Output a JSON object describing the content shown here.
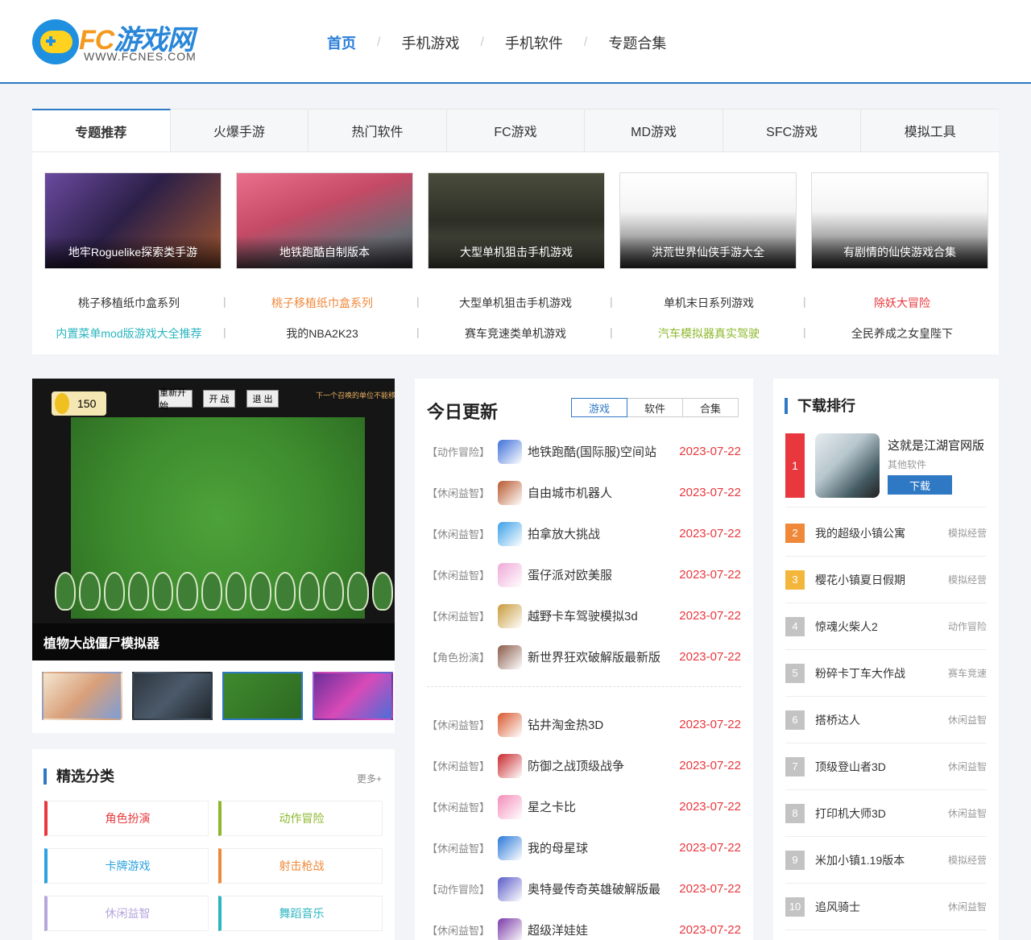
{
  "logo": {
    "title_fc": "FC",
    "title_rest": "游戏网",
    "url": "WWW.FCNES.COM"
  },
  "nav": [
    {
      "label": "首页",
      "active": true
    },
    {
      "label": "手机游戏"
    },
    {
      "label": "手机软件"
    },
    {
      "label": "专题合集"
    }
  ],
  "nav_sep": "/",
  "topics": {
    "tabs": [
      "专题推荐",
      "火爆手游",
      "热门软件",
      "FC游戏",
      "MD游戏",
      "SFC游戏",
      "模拟工具"
    ],
    "cards": [
      "地牢Roguelike探索类手游",
      "地铁跑酷自制版本",
      "大型单机狙击手机游戏",
      "洪荒世界仙侠手游大全",
      "有剧情的仙侠游戏合集"
    ],
    "links_row1": [
      {
        "text": "桃子移植纸巾盒系列",
        "color": "#333333"
      },
      {
        "text": "桃子移植纸巾盒系列",
        "color": "#f0883a"
      },
      {
        "text": "大型单机狙击手机游戏",
        "color": "#333333"
      },
      {
        "text": "单机末日系列游戏",
        "color": "#333333"
      },
      {
        "text": "除妖大冒险",
        "color": "#e8383d"
      }
    ],
    "links_row2": [
      {
        "text": "内置菜单mod版游戏大全推荐",
        "color": "#2bb5c0"
      },
      {
        "text": "我的NBA2K23",
        "color": "#333333"
      },
      {
        "text": "赛车竞速类单机游戏",
        "color": "#333333"
      },
      {
        "text": "汽车模拟器真实驾驶",
        "color": "#8cb82b"
      },
      {
        "text": "全民养成之女皇陛下",
        "color": "#333333"
      }
    ]
  },
  "slider": {
    "caption": "植物大战僵尸模拟器",
    "game": {
      "coins": "150",
      "btn_restart": "重新开始",
      "btn_fight": "开 战",
      "btn_exit": "退 出",
      "hint": "下一个召唤的单位不能移动"
    }
  },
  "categories": {
    "title": "精选分类",
    "more": "更多+",
    "items": [
      {
        "label": "角色扮演",
        "color": "#e8383d"
      },
      {
        "label": "动作冒险",
        "color": "#8cb82b"
      },
      {
        "label": "卡牌游戏",
        "color": "#2ba3e0"
      },
      {
        "label": "射击枪战",
        "color": "#f0883a"
      },
      {
        "label": "休闲益智",
        "color": "#b6a6dc"
      },
      {
        "label": "舞蹈音乐",
        "color": "#2bb5c0"
      }
    ]
  },
  "updates": {
    "title": "今日更新",
    "tabs": [
      "游戏",
      "软件",
      "合集"
    ],
    "group1": [
      {
        "cat": "【动作冒险】",
        "name": "地铁跑酷(国际服)空间站",
        "date": "2023-07-22",
        "icon": "#3d6fd8"
      },
      {
        "cat": "【休闲益智】",
        "name": "自由城市机器人",
        "date": "2023-07-22",
        "icon": "#b8582e"
      },
      {
        "cat": "【休闲益智】",
        "name": "拍拿放大挑战",
        "date": "2023-07-22",
        "icon": "#3aa0e8"
      },
      {
        "cat": "【休闲益智】",
        "name": "蛋仔派对欧美服",
        "date": "2023-07-22",
        "icon": "#f0a8d8"
      },
      {
        "cat": "【休闲益智】",
        "name": "越野卡车驾驶模拟3d",
        "date": "2023-07-22",
        "icon": "#c89a3a"
      },
      {
        "cat": "【角色扮演】",
        "name": "新世界狂欢破解版最新版",
        "date": "2023-07-22",
        "icon": "#8a5a4a"
      }
    ],
    "group2": [
      {
        "cat": "【休闲益智】",
        "name": "钻井淘金热3D",
        "date": "2023-07-22",
        "icon": "#d8582e"
      },
      {
        "cat": "【休闲益智】",
        "name": "防御之战顶级战争",
        "date": "2023-07-22",
        "icon": "#c8282e"
      },
      {
        "cat": "【休闲益智】",
        "name": "星之卡比",
        "date": "2023-07-22",
        "icon": "#f48cb8"
      },
      {
        "cat": "【休闲益智】",
        "name": "我的母星球",
        "date": "2023-07-22",
        "icon": "#2a78d8"
      },
      {
        "cat": "【动作冒险】",
        "name": "奥特曼传奇英雄破解版最",
        "date": "2023-07-22",
        "icon": "#5a5ac8"
      },
      {
        "cat": "【休闲益智】",
        "name": "超级洋娃娃",
        "date": "2023-07-22",
        "icon": "#7a3aa8"
      }
    ]
  },
  "ranks": {
    "title": "下载排行",
    "top": {
      "num": "1",
      "name": "这就是江湖官网版",
      "type": "其他软件",
      "download": "下载"
    },
    "items": [
      {
        "num": "2",
        "name": "我的超级小镇公寓",
        "type": "模拟经营",
        "color": "#f0883a"
      },
      {
        "num": "3",
        "name": "樱花小镇夏日假期",
        "type": "模拟经营",
        "color": "#f4b63a"
      },
      {
        "num": "4",
        "name": "惊魂火柴人2",
        "type": "动作冒险",
        "color": "#c3c3c3"
      },
      {
        "num": "5",
        "name": "粉碎卡丁车大作战",
        "type": "赛车竞速",
        "color": "#c3c3c3"
      },
      {
        "num": "6",
        "name": "搭桥达人",
        "type": "休闲益智",
        "color": "#c3c3c3"
      },
      {
        "num": "7",
        "name": "顶级登山者3D",
        "type": "休闲益智",
        "color": "#c3c3c3"
      },
      {
        "num": "8",
        "name": "打印机大师3D",
        "type": "休闲益智",
        "color": "#c3c3c3"
      },
      {
        "num": "9",
        "name": "米加小镇1.19版本",
        "type": "模拟经营",
        "color": "#c3c3c3"
      },
      {
        "num": "10",
        "name": "追风骑士",
        "type": "休闲益智",
        "color": "#c3c3c3"
      }
    ]
  }
}
